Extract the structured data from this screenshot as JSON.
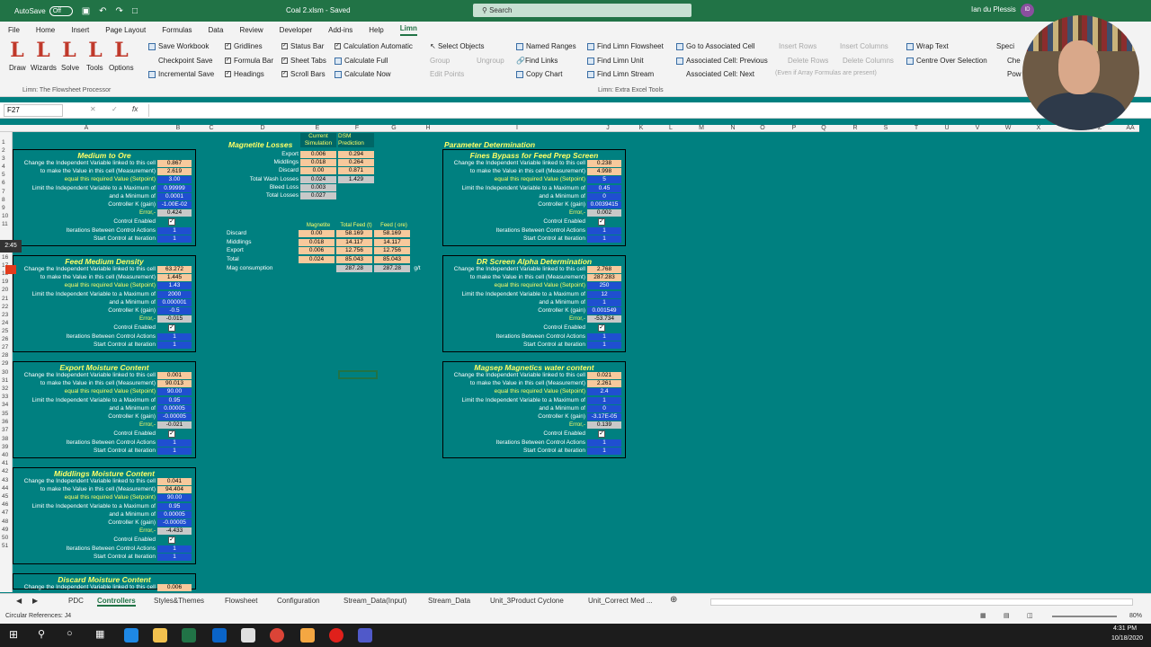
{
  "titlebar": {
    "autosave": "AutoSave",
    "toggle": "Off",
    "doc": "Coal 2.xlsm - Saved",
    "search": "Search",
    "user": "Ian du Plessis",
    "initials": "ID"
  },
  "menu": [
    "File",
    "Home",
    "Insert",
    "Page Layout",
    "Formulas",
    "Data",
    "Review",
    "Developer",
    "Add-ins",
    "Help",
    "Limn"
  ],
  "ribbon": {
    "big": [
      "Draw",
      "Wizards",
      "Solve",
      "Tools",
      "Options"
    ],
    "group1_label": "Limn: The Flowsheet Processor",
    "col1": [
      "Save Workbook",
      "Checkpoint Save",
      "Incremental Save"
    ],
    "col2": [
      "Gridlines",
      "Formula Bar",
      "Headings"
    ],
    "col3": [
      "Status Bar",
      "Sheet Tabs",
      "Scroll Bars"
    ],
    "col4": [
      "Calculation Automatic",
      "Calculate Full",
      "Calculate Now"
    ],
    "col5": [
      "Select Objects",
      "Group",
      "Ungroup",
      "Edit Points"
    ],
    "col6": [
      "Named Ranges",
      "Find Links",
      "Copy Chart"
    ],
    "col7": [
      "Find Limn Flowsheet",
      "Find Limn Unit",
      "Find Limn Stream"
    ],
    "col8": [
      "Go to Associated Cell",
      "Associated Cell: Previous",
      "Associated Cell: Next"
    ],
    "col9": [
      "Insert Rows",
      "Delete Rows",
      "(Even if Array Formulas are present)"
    ],
    "col10": [
      "Insert Columns",
      "Delete Columns"
    ],
    "col11": [
      "Wrap Text",
      "Centre Over Selection"
    ],
    "col12": [
      "Speci",
      "Che",
      "Pow"
    ],
    "group2_label": "Limn: Extra Excel Tools"
  },
  "formula": {
    "namebox": "F27",
    "fx": "fx"
  },
  "columns": [
    "A",
    "B",
    "C",
    "D",
    "E",
    "F",
    "G",
    "H",
    "I",
    "J",
    "K",
    "L",
    "M",
    "N",
    "O",
    "P",
    "Q",
    "R",
    "S",
    "T",
    "U",
    "V",
    "W",
    "X",
    "Y",
    "Z",
    "AA"
  ],
  "rows": [
    "1",
    "2",
    "3",
    "4",
    "5",
    "6",
    "7",
    "8",
    "9",
    "10",
    "11",
    "16",
    "17",
    "18",
    "19",
    "20",
    "21",
    "22",
    "23",
    "24",
    "25",
    "26",
    "27",
    "28",
    "29",
    "30",
    "31",
    "32",
    "33",
    "34",
    "35",
    "36",
    "37",
    "38",
    "39",
    "40",
    "41",
    "42",
    "43",
    "44",
    "45",
    "46",
    "47",
    "48",
    "49",
    "50",
    "51"
  ],
  "labels": {
    "l1": "Change the Independent Variable linked to this cell",
    "l2": "to make the Value in this cell (Measurement)",
    "l3": "equal this required Value (Setpoint)",
    "l4": "Limit the Independent Variable to a Maximum of",
    "l5": "and a Minimum of",
    "l6": "Controller K (gain)",
    "l7": "Error,-",
    "l8": "Control Enabled",
    "l9": "Iterations Between Control Actions",
    "l10": "Start Control at Iteration"
  },
  "controllers_left": [
    {
      "title": "Medium to Ore",
      "values": [
        "0.867",
        "2.619",
        "3.00",
        "0.99999",
        "0.0001",
        "-1.00E-02",
        "0.424"
      ],
      "iter": [
        "1",
        "1"
      ]
    },
    {
      "title": "Feed Medium Density",
      "values": [
        "63.272",
        "1.445",
        "1.43",
        "2000",
        "0.000001",
        "-0.5",
        "-0.015"
      ],
      "iter": [
        "1",
        "1"
      ]
    },
    {
      "title": "Export Moisture Content",
      "values": [
        "0.001",
        "90.013",
        "90.00",
        "0.95",
        "0.00005",
        "-0.00005",
        "-0.021"
      ],
      "iter": [
        "1",
        "1"
      ]
    },
    {
      "title": "Middlings Moisture Content",
      "values": [
        "0.041",
        "94.404",
        "90.00",
        "0.95",
        "0.00005",
        "-0.00005",
        "-4.433"
      ],
      "iter": [
        "1",
        "1"
      ]
    },
    {
      "title": "Discard Moisture Content",
      "values": [
        "0.006"
      ],
      "iter": []
    }
  ],
  "controllers_right_header": "Parameter Determination",
  "controllers_right": [
    {
      "title": "Fines Bypass for Feed Prep Screen",
      "values": [
        "0.238",
        "4.998",
        "5",
        "0.45",
        "0",
        "0.0039415",
        "0.002"
      ],
      "iter": [
        "1",
        "1"
      ]
    },
    {
      "title": "DR Screen Alpha Determination",
      "values": [
        "2.768",
        "287.283",
        "250",
        "12",
        "1",
        "0.001549",
        "-53.734"
      ],
      "iter": [
        "1",
        "1"
      ]
    },
    {
      "title": "Magsep Magnetics water content",
      "values": [
        "0.021",
        "2.261",
        "2.4",
        "1",
        "0",
        "-3.17E-05",
        "0.139"
      ],
      "iter": [
        "1",
        "1"
      ]
    }
  ],
  "magnetite": {
    "title": "Magnetite Losses",
    "col1": "Current Simulation",
    "col2": "DSM Prediction",
    "rows": [
      [
        "Export",
        "0.006",
        "0.294"
      ],
      [
        "Middlings",
        "0.018",
        "0.264"
      ],
      [
        "Discard",
        "0.00",
        "0.871"
      ],
      [
        "Total Wash Losses",
        "0.024",
        "1.429"
      ],
      [
        "Bleed Loss",
        "0.003",
        ""
      ],
      [
        "Total Losses",
        "0.027",
        ""
      ]
    ]
  },
  "feedtable": {
    "headers": [
      "Magnetite",
      "Total Feed (t)",
      "Feed ( ore)"
    ],
    "rows": [
      [
        "Discard",
        "0.00",
        "58.169",
        "58.169"
      ],
      [
        "Middlings",
        "0.018",
        "14.117",
        "14.117"
      ],
      [
        "Export",
        "0.006",
        "12.756",
        "12.756"
      ],
      [
        "Total",
        "0.024",
        "85.043",
        "85.043"
      ]
    ],
    "consumption_label": "Mag consumption",
    "consumption": [
      "287.28",
      "287.28"
    ],
    "unit": "g/t"
  },
  "tabs": [
    "PDC",
    "Controllers",
    "Styles&Themes",
    "Flowsheet",
    "Configuration",
    "Stream_Data(Input)",
    "Stream_Data",
    "Unit_3Product Cyclone",
    "Unit_Correct Med ..."
  ],
  "status": {
    "left": "Circular References: J4",
    "zoom": "80%"
  },
  "timer": "2:45",
  "clock": {
    "time": "4:31 PM",
    "date": "10/18/2020"
  }
}
